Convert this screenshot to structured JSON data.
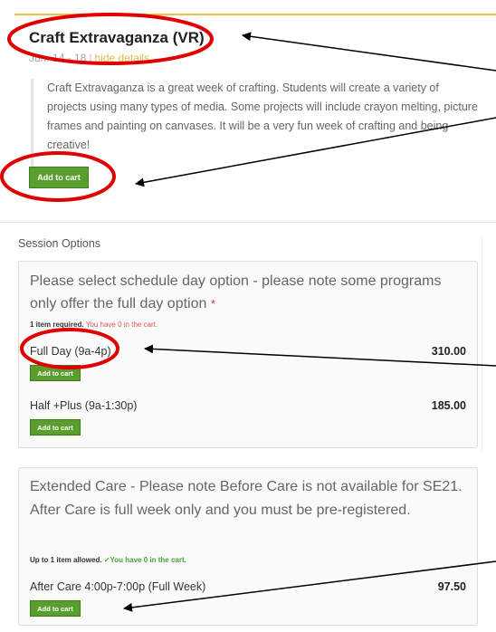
{
  "product": {
    "title": "Craft Extravaganza (VR)",
    "dates": "Jun. 14 - 18",
    "separator": "|",
    "hide_details": "hide details",
    "description": "Craft Extravaganza is a great week of crafting. Students will create a variety of projects using many types of media. Some projects will include crayon melting, picture frames and painting on canvases. It will be a very fun week of crafting and being creative!",
    "add_to_cart": "Add to cart"
  },
  "session_options_label": "Session Options",
  "schedule_group": {
    "heading": "Please select schedule day option - please note some programs only offer the full day option",
    "required_mark": "*",
    "requirement": "1 item required.",
    "status": "You have 0 in the cart.",
    "options": [
      {
        "name": "Full Day (9a-4p)",
        "price": "310.00",
        "button": "Add to cart"
      },
      {
        "name": "Half +Plus (9a-1:30p)",
        "price": "185.00",
        "button": "Add to cart"
      }
    ]
  },
  "extended_group": {
    "heading": "Extended Care - Please note Before Care is not available for SE21. After Care is full week only and you must be pre-registered.",
    "requirement": "Up to 1 item allowed.",
    "status_icon": "check-icon",
    "status": "You have 0 in the cart.",
    "options": [
      {
        "name": "After Care 4:00p-7:00p (Full Week)",
        "price": "97.50",
        "button": "Add to cart"
      }
    ]
  },
  "colors": {
    "accent_top_border": "#e8c04a",
    "button_green": "#5a9f2d",
    "annotation_red": "#e00000",
    "status_red": "#e05555",
    "status_green": "#4ca03a"
  }
}
